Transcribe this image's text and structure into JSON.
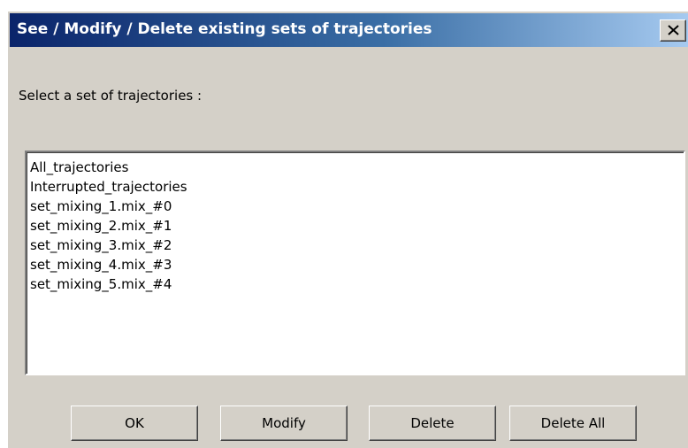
{
  "window": {
    "title": "See / Modify / Delete existing sets of trajectories",
    "close_icon": "close-icon"
  },
  "prompt": "Select a set of trajectories :",
  "list": {
    "items": [
      "All_trajectories",
      "Interrupted_trajectories",
      "set_mixing_1.mix_#0",
      "set_mixing_2.mix_#1",
      "set_mixing_3.mix_#2",
      "set_mixing_4.mix_#3",
      "set_mixing_5.mix_#4"
    ]
  },
  "buttons": {
    "ok": "OK",
    "modify": "Modify",
    "delete": "Delete",
    "delete_all": "Delete All"
  },
  "colors": {
    "dialog_bg": "#d4d0c8",
    "title_gradient_start": "#0a246a",
    "title_gradient_end": "#a6caf0"
  }
}
